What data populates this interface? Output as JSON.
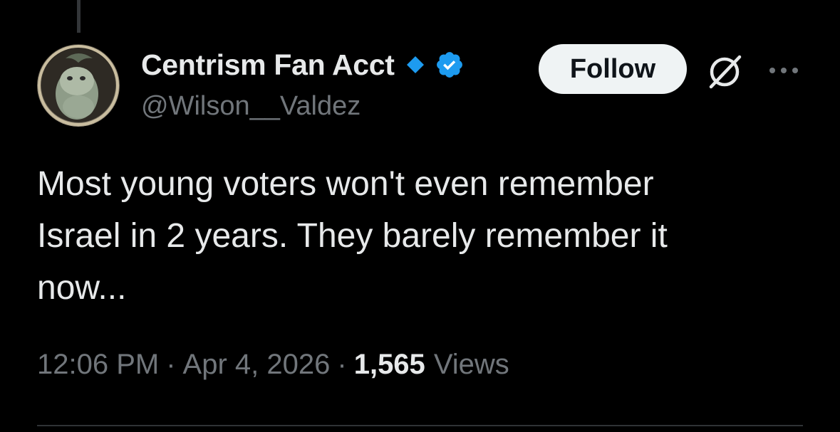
{
  "colors": {
    "background": "#000000",
    "text_primary": "#e7e9ea",
    "text_secondary": "#71767b",
    "verified_blue": "#1d9bf0",
    "affiliation_diamond": "#1d9bf0",
    "follow_button_bg": "#eff3f4",
    "follow_button_text": "#0f1419",
    "divider": "#2f3336"
  },
  "author": {
    "display_name": "Centrism Fan Acct",
    "handle": "@Wilson__Valdez",
    "avatar_icon": "profile-avatar",
    "affiliation_icon": "diamond-icon",
    "verified_icon": "verified-badge-icon"
  },
  "actions": {
    "follow_label": "Follow",
    "grok_icon": "grok-icon",
    "more_icon": "more-options-icon"
  },
  "tweet": {
    "text_lines": [
      "Most young voters won't even remember",
      "Israel in 2 years. They barely remember it",
      "now..."
    ]
  },
  "meta": {
    "time": "12:06 PM",
    "separator": "·",
    "date": "Apr 4, 2026",
    "views_count": "1,565",
    "views_label": "Views"
  }
}
